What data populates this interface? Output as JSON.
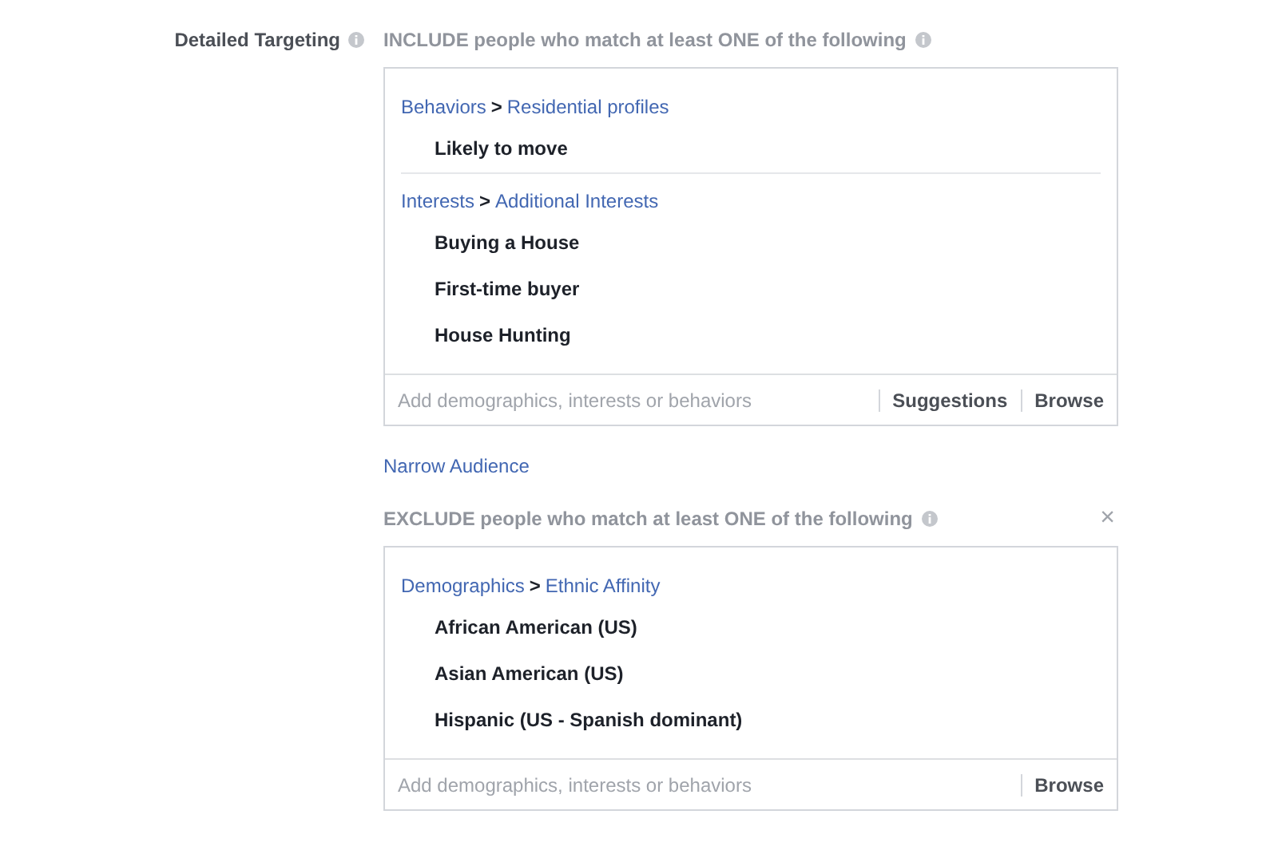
{
  "section": {
    "label": "Detailed Targeting"
  },
  "include": {
    "heading": "INCLUDE people who match at least ONE of the following",
    "groups": [
      {
        "path": [
          "Behaviors",
          "Residential profiles"
        ],
        "separator": ">",
        "items": [
          "Likely to move"
        ]
      },
      {
        "path": [
          "Interests",
          "Additional Interests"
        ],
        "separator": ">",
        "items": [
          "Buying a House",
          "First-time buyer",
          "House Hunting"
        ]
      }
    ],
    "search": {
      "placeholder": "Add demographics, interests or behaviors"
    },
    "actions": [
      "Suggestions",
      "Browse"
    ]
  },
  "narrow_link": "Narrow Audience",
  "exclude": {
    "heading": "EXCLUDE people who match at least ONE of the following",
    "close": "×",
    "groups": [
      {
        "path": [
          "Demographics",
          "Ethnic Affinity"
        ],
        "separator": ">",
        "items": [
          "African American (US)",
          "Asian American (US)",
          "Hispanic (US - Spanish dominant)"
        ]
      }
    ],
    "search": {
      "placeholder": "Add demographics, interests or behaviors"
    },
    "actions": [
      "Browse"
    ]
  }
}
